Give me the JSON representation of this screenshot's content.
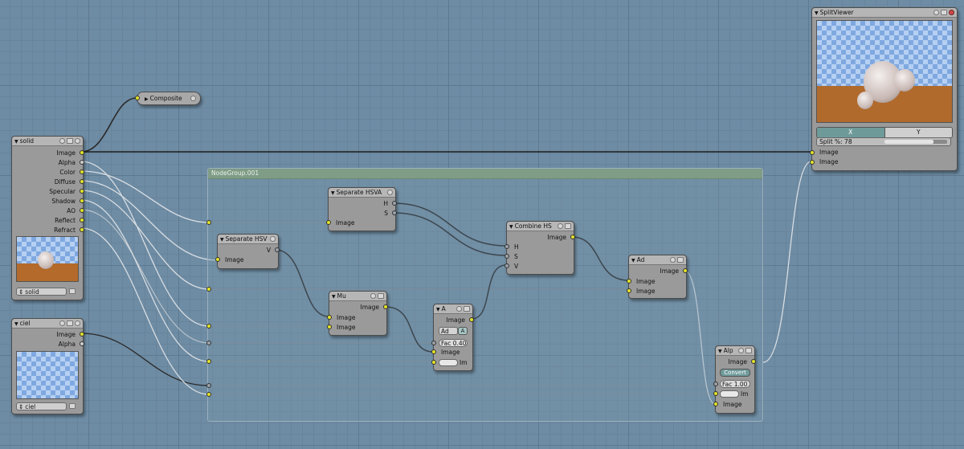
{
  "colors": {
    "socket_color": "#e2e22a",
    "socket_gray": "#9aa2aa",
    "group_header": "#7f9c86"
  },
  "composite": {
    "title": "Composite"
  },
  "solid": {
    "title": "solid",
    "outputs": [
      "Image",
      "Alpha",
      "Color",
      "Diffuse",
      "Specular",
      "Shadow",
      "AO",
      "Reflect",
      "Refract"
    ],
    "scene_value": "solid"
  },
  "ciel": {
    "title": "ciel",
    "outputs": [
      "Image",
      "Alpha"
    ],
    "scene_value": "ciel"
  },
  "group": {
    "title": "NodeGroup.001"
  },
  "sep_hsva": {
    "title": "Separate HSVA",
    "out_h": "H",
    "out_s": "S",
    "in_image": "Image"
  },
  "sep_hsv": {
    "title": "Separate HSV",
    "out_v": "V",
    "in_image": "Image"
  },
  "mu": {
    "title": "Mu",
    "out_image": "Image",
    "in1": "Image",
    "in2": "Image"
  },
  "a_node": {
    "title": "A",
    "out_image": "Image",
    "mode": "Ad",
    "mode_alpha": "A",
    "fac": "Fac 0.40",
    "in_image": "Image",
    "in_im": "Im"
  },
  "combine_hs": {
    "title": "Combine HS",
    "out_image": "Image",
    "in_h": "H",
    "in_s": "S",
    "in_v": "V"
  },
  "ad_node": {
    "title": "Ad",
    "out_image": "Image",
    "in1": "Image",
    "in2": "Image"
  },
  "alp_node": {
    "title": "Alp",
    "out_image": "Image",
    "convert": "Convert",
    "fac": "Fac 1.00",
    "in_im": "Im",
    "in_image": "Image"
  },
  "splitviewer": {
    "title": "SplitViewer",
    "axis_x": "X",
    "axis_y": "Y",
    "split": "Split %: 78",
    "split_fraction": 0.78,
    "in1": "Image",
    "in2": "Image"
  }
}
